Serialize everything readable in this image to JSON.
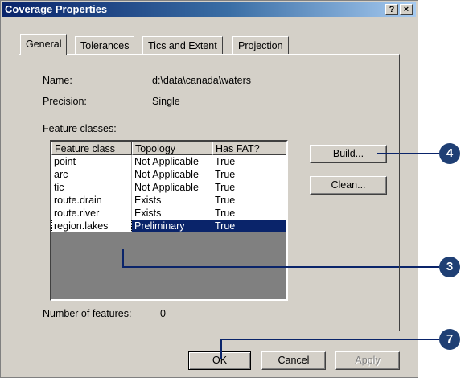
{
  "window": {
    "title": "Coverage Properties",
    "help_label": "?",
    "close_label": "×"
  },
  "tabs": [
    {
      "label": "General",
      "active": true
    },
    {
      "label": "Tolerances",
      "active": false
    },
    {
      "label": "Tics and Extent",
      "active": false
    },
    {
      "label": "Projection",
      "active": false
    }
  ],
  "general": {
    "name_label": "Name:",
    "name_value": "d:\\data\\canada\\waters",
    "precision_label": "Precision:",
    "precision_value": "Single",
    "feature_classes_label": "Feature classes:",
    "number_of_features_label": "Number of features:",
    "number_of_features_value": "0"
  },
  "feature_table": {
    "columns": [
      "Feature class",
      "Topology",
      "Has FAT?"
    ],
    "rows": [
      {
        "feature_class": "point",
        "topology": "Not Applicable",
        "has_fat": "True"
      },
      {
        "feature_class": "arc",
        "topology": "Not Applicable",
        "has_fat": "True"
      },
      {
        "feature_class": "tic",
        "topology": "Not Applicable",
        "has_fat": "True"
      },
      {
        "feature_class": "route.drain",
        "topology": "Exists",
        "has_fat": "True"
      },
      {
        "feature_class": "route.river",
        "topology": "Exists",
        "has_fat": "True"
      },
      {
        "feature_class": "region.lakes",
        "topology": "Preliminary",
        "has_fat": "True"
      }
    ],
    "selected_row": 5
  },
  "side_buttons": {
    "build": "Build...",
    "clean": "Clean..."
  },
  "footer_buttons": {
    "ok": "OK",
    "cancel": "Cancel",
    "apply": "Apply"
  },
  "callouts": {
    "build": "4",
    "region_lakes": "3",
    "ok": "7"
  },
  "colors": {
    "selection": "#0a246a",
    "callout": "#1f3f74",
    "dialog_face": "#d4d0c8"
  }
}
